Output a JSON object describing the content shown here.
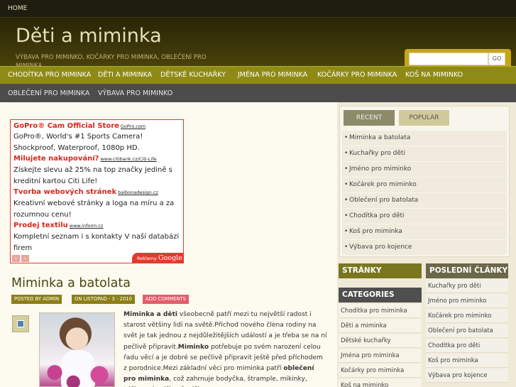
{
  "topbar": {
    "home": "HOME"
  },
  "header": {
    "title": "Děti a miminka",
    "description": "VÝBAVA PRO MIMINKO, KOČÁRKY PRO MIMINKA, OBLEČENÍ PRO MIMINKA"
  },
  "search": {
    "placeholder": "",
    "button": "GO"
  },
  "nav_primary": [
    "CHODÍTKA PRO MIMINKA",
    "DĚTI A MIMINKA",
    "DĚTSKÉ KUCHAŘKY",
    "JMÉNA PRO MIMINKA",
    "KOČÁRKY PRO MIMINKA",
    "KOŠ NA MIMINKO"
  ],
  "nav_secondary": [
    "OBLEČENÍ PRO MIMINKA",
    "VÝBAVA PRO MIMINKO"
  ],
  "ads": {
    "items": [
      {
        "title": "GoPro® Cam Official Store",
        "url": "GoPro.com",
        "text": "GoPro®, World's #1 Sports Camera! Shockproof, Waterproof, 1080p HD."
      },
      {
        "title": "Milujete nakupování?",
        "url": "www.citibank.cz/Citi-Life",
        "text": "Získejte slevu až 25% na top značky jedině s kreditní kartou Citi Life!"
      },
      {
        "title": "Tvorba webových stránek",
        "url": "baibonadesign.cz",
        "text": "Kreativní webové stránky a loga na míru a za rozumnou cenu!"
      },
      {
        "title": "Prodej textilu",
        "url": "www.inform.cz",
        "text": "Kompletní seznam i s kontakty V naší databázi firem"
      }
    ],
    "label_prefix": "Reklamy",
    "label_brand": "Google",
    "prev": "‹",
    "next": "›"
  },
  "post": {
    "title": "Miminka a batolata",
    "author": "POSTED BY ADMIN",
    "date": "ON LISTOPAD - 3 - 2010",
    "comments": "ADD COMMENTS",
    "intro_bold": "Miminka a děti",
    "body_1": " všeobecně patří mezi tu největší radost i starost většiny lidí na světě.Příchod nového člena rodiny na svět je tak jednou z nejdůležitějších událostí a je třeba se na ní pečlivě připravit.",
    "bold_2": "Miminko",
    "body_2": " potřebuje po svém narození celou řadu věcí a je dobré se pečlivě připravit ještě před příchodem z porodnice.Mezi základní věci pro miminka patří ",
    "bold_3": "oblečení pro miminka",
    "body_3": ", což zahrnuje bodyčka, štrample, mikinky, trička, rukavičky, čepičky,"
  },
  "tabs": {
    "recent": "RECENT",
    "popular": "POPULAR",
    "items": [
      "Miminka a batolata",
      "Kuchařky pro děti",
      "Jméno pro miminko",
      "Kočárek pro miminko",
      "Oblečení pro batolata",
      "Chodítka pro děti",
      "Koš pro miminka",
      "Výbava pro kojence"
    ]
  },
  "widgets": {
    "pages": "STRÁNKY",
    "categories": "CATEGORIES",
    "category_items": [
      "Chodítka pro miminka",
      "Děti a miminka",
      "Dětské kuchařky",
      "Jména pro miminka",
      "Kočárky pro miminka",
      "Koš na miminko"
    ],
    "latest": "POSLEDNÍ ČLÁNKY",
    "latest_items": [
      "Kuchařky pro děti",
      "Jméno pro miminko",
      "Kočárek pro miminko",
      "Oblečení pro batolata",
      "Chodítka pro děti",
      "Koš pro miminka",
      "Výbava pro kojence"
    ]
  }
}
